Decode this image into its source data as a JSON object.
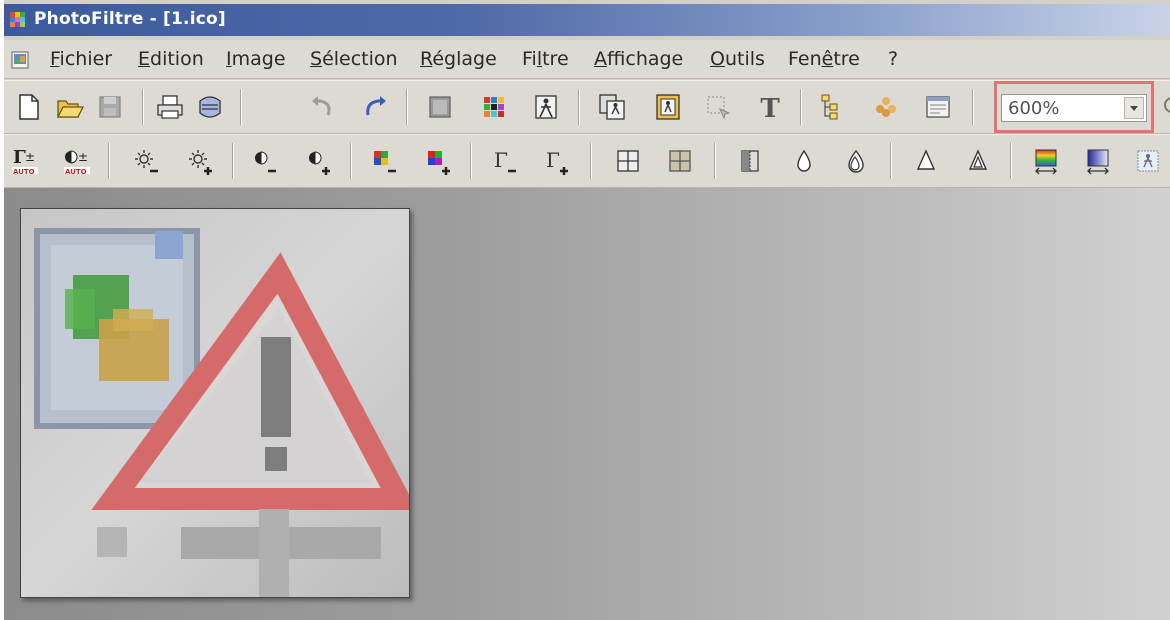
{
  "window": {
    "title": "PhotoFiltre - [1.ico]"
  },
  "menu": [
    {
      "pre": "",
      "acc": "F",
      "post": "ichier"
    },
    {
      "pre": "",
      "acc": "E",
      "post": "dition"
    },
    {
      "pre": "",
      "acc": "I",
      "post": "mage"
    },
    {
      "pre": "",
      "acc": "S",
      "post": "élection"
    },
    {
      "pre": "",
      "acc": "R",
      "post": "églage"
    },
    {
      "pre": "Fi",
      "acc": "l",
      "post": "tre"
    },
    {
      "pre": "",
      "acc": "A",
      "post": "ffichage"
    },
    {
      "pre": "",
      "acc": "O",
      "post": "utils"
    },
    {
      "pre": "Fen",
      "acc": "ê",
      "post": "tre"
    },
    {
      "pre": "",
      "acc": "",
      "post": "?"
    }
  ],
  "toolbar": {
    "zoom_value": "600%"
  },
  "icons": {
    "app": "photofiltre-app-icon",
    "document": "document-icon"
  }
}
